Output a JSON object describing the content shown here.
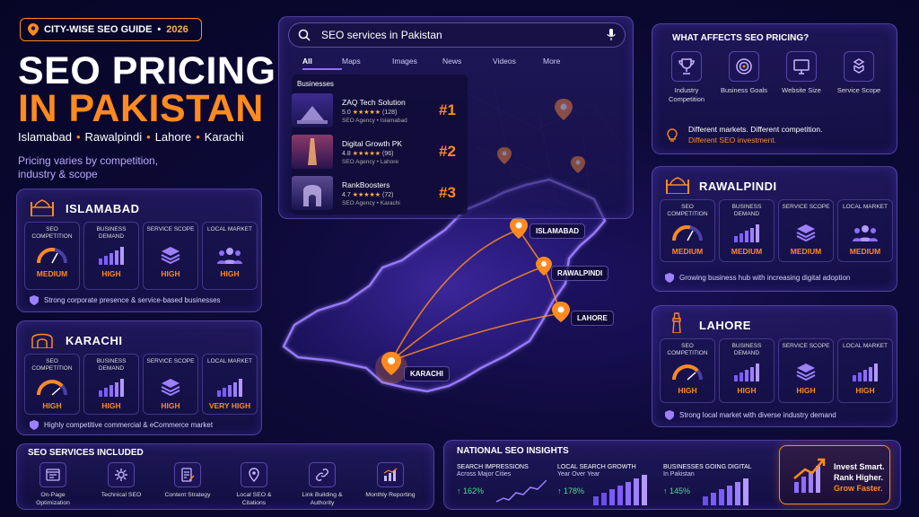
{
  "header": {
    "tag": "CITY-WISE SEO GUIDE",
    "year": "2026",
    "title_line1": "SEO PRICING",
    "title_line2": "IN PAKISTAN",
    "cities": [
      "Islamabad",
      "Rawalpindi",
      "Lahore",
      "Karachi"
    ],
    "subtitle_line1": "Pricing varies by competition,",
    "subtitle_line2": "industry & scope"
  },
  "metric_labels": {
    "seo_competition": "SEO COMPETITION",
    "business_demand": "BUSINESS DEMAND",
    "service_scope": "SERVICE SCOPE",
    "local_market": "LOCAL MARKET"
  },
  "cards": {
    "islamabad": {
      "name": "ISLAMABAD",
      "values": [
        "MEDIUM",
        "HIGH",
        "HIGH",
        "HIGH"
      ],
      "note": "Strong corporate presence & service-based businesses"
    },
    "karachi": {
      "name": "KARACHI",
      "values": [
        "HIGH",
        "HIGH",
        "HIGH",
        "VERY HIGH"
      ],
      "note": "Highly competitive commercial & eCommerce market"
    },
    "rawalpindi": {
      "name": "RAWALPINDI",
      "values": [
        "MEDIUM",
        "MEDIUM",
        "MEDIUM",
        "MEDIUM"
      ],
      "note": "Growing business hub with increasing digital adoption"
    },
    "lahore": {
      "name": "LAHORE",
      "values": [
        "HIGH",
        "HIGH",
        "HIGH",
        "HIGH"
      ],
      "note": "Strong local market with diverse industry demand"
    }
  },
  "search": {
    "query": "SEO services in Pakistan",
    "tabs": [
      "All",
      "Maps",
      "Images",
      "News",
      "Videos",
      "More"
    ],
    "section": "Businesses",
    "results": [
      {
        "name": "ZAQ Tech Solution",
        "rating": "5.0",
        "stars": "★★★★★",
        "reviews": "(128)",
        "type": "SEO Agency • Islamabad",
        "rank": "#1"
      },
      {
        "name": "Digital Growth PK",
        "rating": "4.8",
        "stars": "★★★★★",
        "reviews": "(96)",
        "type": "SEO Agency • Lahore",
        "rank": "#2"
      },
      {
        "name": "RankBoosters",
        "rating": "4.7",
        "stars": "★★★★★",
        "reviews": "(72)",
        "type": "SEO Agency • Karachi",
        "rank": "#3"
      }
    ]
  },
  "affects": {
    "title": "WHAT AFFECTS SEO PRICING?",
    "factors": [
      "Industry Competition",
      "Business Goals",
      "Website Size",
      "Service Scope"
    ],
    "note1": "Different markets. Different competition.",
    "note2": "Different SEO investment."
  },
  "map_labels": [
    "ISLAMABAD",
    "RAWALPINDI",
    "LAHORE",
    "KARACHI"
  ],
  "services": {
    "title": "SEO SERVICES INCLUDED",
    "items": [
      "On-Page Optimization",
      "Technical SEO",
      "Content Strategy",
      "Local SEO & Citations",
      "Link Building & Authority",
      "Monthly Reporting"
    ]
  },
  "insights": {
    "title": "NATIONAL SEO INSIGHTS",
    "stats": [
      {
        "label": "SEARCH IMPRESSIONS",
        "sub": "Across Major Cities",
        "value": "↑ 162%"
      },
      {
        "label": "LOCAL SEARCH GROWTH",
        "sub": "Year Over Year",
        "value": "↑ 178%"
      },
      {
        "label": "BUSINESSES GOING DIGITAL",
        "sub": "In Pakistan",
        "value": "↑ 145%"
      }
    ]
  },
  "cta": {
    "line1": "Invest Smart.",
    "line2": "Rank Higher.",
    "line3": "Grow Faster."
  },
  "colors": {
    "accent": "#ff8a1f",
    "background": "#0e0a38",
    "panel_border": "#9678ff",
    "growth": "#47e08a"
  }
}
